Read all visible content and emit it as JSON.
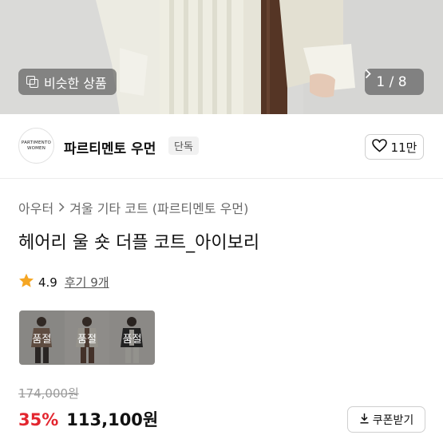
{
  "hero": {
    "similar_label": "비슷한 상품",
    "similar_icon": "similar-items-icon",
    "pager_text": "1 / 8",
    "pager_icon": "chevron-right-icon"
  },
  "brand": {
    "logo_line1": "PARTIMENTO",
    "logo_line2": "WOMEN",
    "name": "파르티멘토 우먼",
    "tag": "단독",
    "like_icon": "heart-icon",
    "like_count": "11만"
  },
  "product": {
    "breadcrumb": [
      "아우터",
      "겨울 기타 코트 (파르티멘토 우먼)"
    ],
    "breadcrumb_icon": "chevron-right-icon",
    "title": "헤어리 울 숏 더플 코트_아이보리",
    "rating_icon": "star-icon",
    "rating": "4.9",
    "reviews": "후기 9개"
  },
  "options": [
    {
      "sold_label": "품절"
    },
    {
      "sold_label": "품절"
    },
    {
      "sold_label": "품절"
    }
  ],
  "price": {
    "original": "174,000원",
    "discount": "35%",
    "sale": "113,100원",
    "coupon_label": "쿠폰받기",
    "coupon_icon": "download-icon"
  },
  "colors": {
    "accent_red": "#e3262f",
    "star": "#f5a623"
  }
}
